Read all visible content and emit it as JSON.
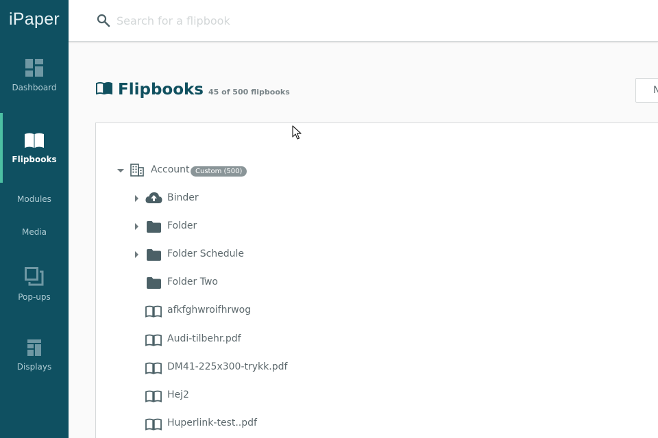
{
  "app": {
    "logo": "iPaper"
  },
  "sidebar": {
    "items": [
      {
        "label": "Dashboard",
        "icon": "dashboard-icon",
        "active": false
      },
      {
        "label": "Flipbooks",
        "icon": "book-icon",
        "active": true
      },
      {
        "label": "Modules",
        "icon": "",
        "active": false
      },
      {
        "label": "Media",
        "icon": "",
        "active": false
      },
      {
        "label": "Pop-ups",
        "icon": "popups-icon",
        "active": false
      },
      {
        "label": "Displays",
        "icon": "displays-icon",
        "active": false
      }
    ]
  },
  "header": {
    "search": {
      "placeholder": "Search for a flipbook",
      "value": ""
    }
  },
  "page": {
    "title": "Flipbooks",
    "count": "45 of 500 flipbooks",
    "new_button_label": "N"
  },
  "tree": {
    "root": {
      "label": "Account",
      "badge": "Custom (500)",
      "expanded": true
    },
    "items": [
      {
        "label": "Binder",
        "type": "cloud-folder",
        "expandable": true
      },
      {
        "label": "Folder",
        "type": "folder",
        "expandable": true
      },
      {
        "label": "Folder Schedule",
        "type": "folder",
        "expandable": true
      },
      {
        "label": "Folder Two",
        "type": "folder",
        "expandable": false
      },
      {
        "label": "afkfghwroifhrwog",
        "type": "flipbook",
        "expandable": false
      },
      {
        "label": "Audi-tilbehr.pdf",
        "type": "flipbook",
        "expandable": false
      },
      {
        "label": "DM41-225x300-trykk.pdf",
        "type": "flipbook",
        "expandable": false
      },
      {
        "label": "Hej2",
        "type": "flipbook",
        "expandable": false
      },
      {
        "label": "Huperlink-test..pdf",
        "type": "flipbook",
        "expandable": false
      }
    ]
  },
  "colors": {
    "sidebar_bg": "#0f5061",
    "active_indicator": "#4cc0a3",
    "title": "#10505f",
    "icon": "#4b6066"
  }
}
